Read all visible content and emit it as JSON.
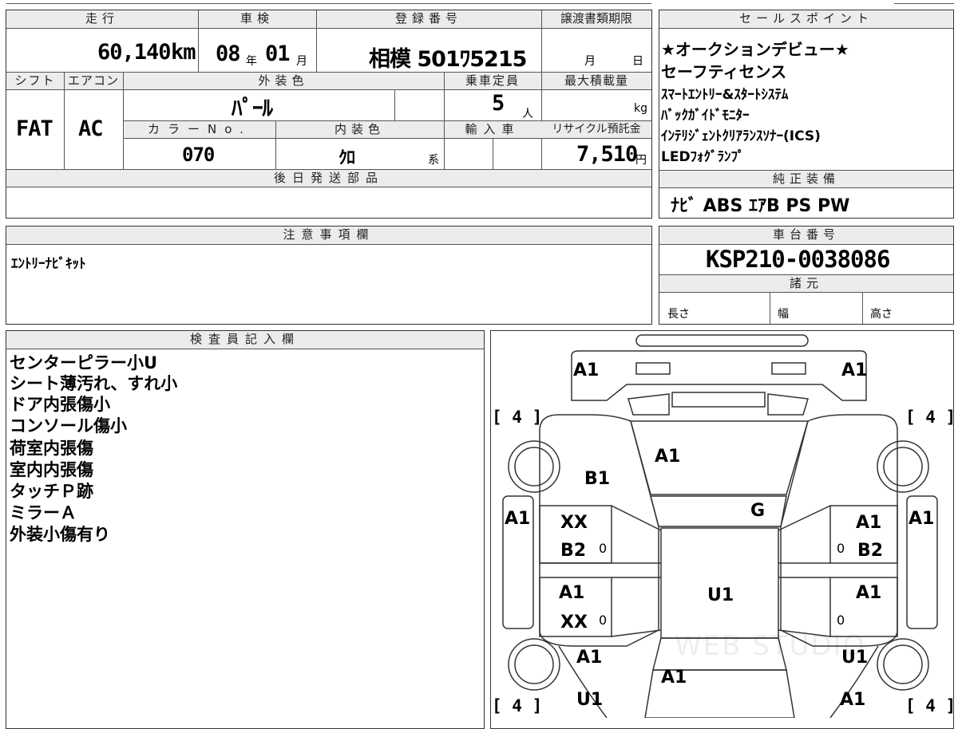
{
  "headers": {
    "mileage": "走行",
    "inspection": "車検",
    "registration": "登録番号",
    "transfer_deadline": "譲渡書類期限",
    "shift": "シフト",
    "aircon": "エアコン",
    "exterior_color": "外装色",
    "capacity": "乗車定員",
    "max_load": "最大積載量",
    "color_no": "カラーNo.",
    "interior_color": "内装色",
    "import": "輸入車",
    "recycle": "リサイクル預託金",
    "parts_later": "後日発送部品",
    "sales_points": "セールスポイント",
    "genuine_equipment": "純正装備",
    "notes": "注意事項欄",
    "chassis_no": "車台番号",
    "specs": "諸元",
    "inspector": "検査員記入欄"
  },
  "values": {
    "mileage": "60,140",
    "mileage_unit": "km",
    "inspection_year": "08",
    "year_unit": "年",
    "inspection_month": "01",
    "month_unit": "月",
    "registration": "相模 501ﾜ5215",
    "deadline_month": "月",
    "deadline_day": "日",
    "shift": "FAT",
    "aircon": "AC",
    "exterior_color": "ﾊﾟｰﾙ",
    "capacity": "5",
    "capacity_unit": "人",
    "load_unit": "kg",
    "color_no": "070",
    "interior_color": "ｸﾛ",
    "interior_suffix": "系",
    "recycle": "7,510",
    "recycle_unit": "円",
    "chassis_no": "KSP210-0038086",
    "length_label": "長さ",
    "width_label": "幅",
    "height_label": "高さ"
  },
  "sales_points": [
    "★オークションデビュー★",
    "セーフティセンス",
    "ｽﾏｰﾄｴﾝﾄﾘｰ&ｽﾀｰﾄｼｽﾃﾑ",
    "ﾊﾞｯｸｶﾞｲﾄﾞﾓﾆﾀｰ",
    "ｲﾝﾃﾘｼﾞｪﾝﾄｸﾘｱﾗﾝｽｿﾅｰ(ICS)",
    "LEDﾌｫｸﾞﾗﾝﾌﾟ"
  ],
  "genuine_equipment": "ﾅﾋﾞ  ABS  ｴｱB  PS  PW",
  "notes_text": "ｴﾝﾄﾘｰﾅﾋﾞｷｯﾄ",
  "inspector_notes": [
    "センターピラー小U",
    "シート薄汚れ、すれ小",
    "ドア内張傷小",
    "コンソール傷小",
    "荷室内張傷",
    "室内内張傷",
    "タッチＰ跡",
    "ミラーＡ",
    "外装小傷有り"
  ],
  "diagram": {
    "tire_bracket": "[ 4 ]",
    "marks": {
      "front_left_corner": "A1",
      "front_right_corner": "A1",
      "hood": "A1",
      "left_fender": "B1",
      "windshield": "G",
      "left_side_outer": "A1",
      "right_side_outer": "A1",
      "lf_door_top": "XX",
      "lf_door_bottom": "B2",
      "rf_door_top": "A1",
      "rf_door_bottom": "B2",
      "roof": "U1",
      "lr_door_top": "A1",
      "lr_door_bottom": "XX",
      "rr_door": "A1",
      "left_quarter": "A1",
      "right_quarter": "U1",
      "trunk": "A1",
      "rear_left": "U1",
      "rear_right": "A1",
      "zero": "0"
    }
  },
  "watermark": "WEB STUDIO"
}
